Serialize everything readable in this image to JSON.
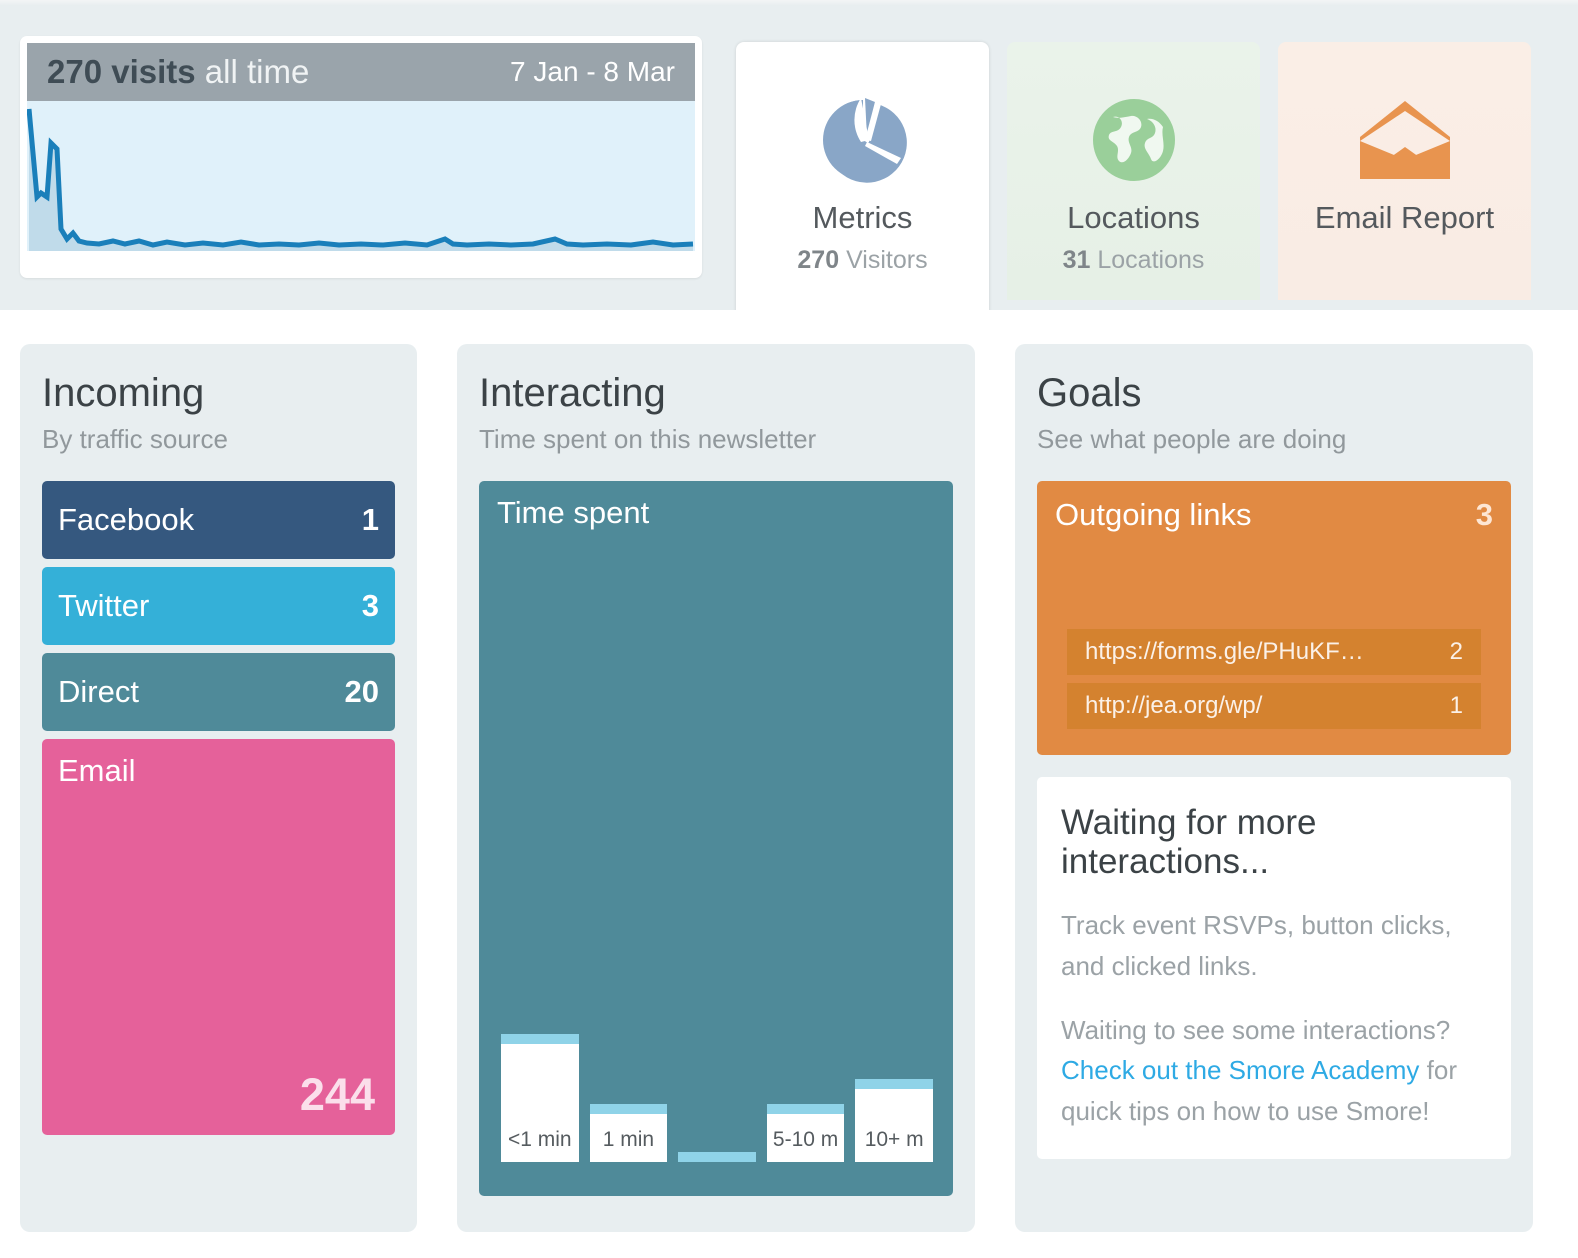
{
  "overview": {
    "visits_count": "270",
    "visits_word": "visits",
    "visits_scope": "all time",
    "date_range": "7 Jan - 8 Mar"
  },
  "tabs": [
    {
      "icon": "pie-chart-icon",
      "label": "Metrics",
      "value": "270",
      "unit": "Visitors"
    },
    {
      "icon": "globe-icon",
      "label": "Locations",
      "value": "31",
      "unit": "Locations"
    },
    {
      "icon": "open-envelope-icon",
      "label": "Email Report",
      "value": "",
      "unit": ""
    }
  ],
  "incoming": {
    "title": "Incoming",
    "subtitle": "By traffic source",
    "sources": [
      {
        "name": "Facebook",
        "value": "1",
        "color": "#35587f"
      },
      {
        "name": "Twitter",
        "value": "3",
        "color": "#34b0d8"
      },
      {
        "name": "Direct",
        "value": "20",
        "color": "#4f8a99"
      },
      {
        "name": "Email",
        "value": "244",
        "color": "#e5619a"
      }
    ]
  },
  "interacting": {
    "title": "Interacting",
    "subtitle": "Time spent on this newsletter",
    "chart_label": "Time spent"
  },
  "goals": {
    "title": "Goals",
    "subtitle": "See what people are doing",
    "goal_name": "Outgoing links",
    "goal_value": "3",
    "links": [
      {
        "url": "https://forms.gle/PHuKF…",
        "value": "2"
      },
      {
        "url": "http://jea.org/wp/",
        "value": "1"
      }
    ],
    "waiting_title": "Waiting for more interactions...",
    "waiting_p1": "Track event RSVPs, button clicks, and clicked links.",
    "waiting_p2_before": "Waiting to see some interactions? ",
    "waiting_link": "Check out the Smore Academy",
    "waiting_p2_after": " for quick tips on how to use Smore!"
  },
  "chart_data": {
    "type": "bar",
    "title": "Time spent",
    "categories": [
      "<1 min",
      "1 min",
      "",
      "5-10 m",
      "10+ m"
    ],
    "values": [
      100,
      42,
      3,
      42,
      63
    ],
    "xlabel": "",
    "ylabel": "",
    "ylim": [
      0,
      100
    ],
    "grid": false,
    "bar_color": "#ffffff",
    "bar_cap_color": "#8fd3e8",
    "plot_background": "#4f8a99"
  },
  "colors": {
    "page_background": "#ffffff",
    "band_background": "#e8eef0",
    "panel_background": "#e8eef0",
    "accent_orange": "#e18a43",
    "accent_pink": "#e5619a",
    "accent_teal": "#4f8a99",
    "link_blue": "#2eaae4",
    "sparkline_line": "#1a7fba",
    "sparkline_fill": "#e0f1fa"
  }
}
